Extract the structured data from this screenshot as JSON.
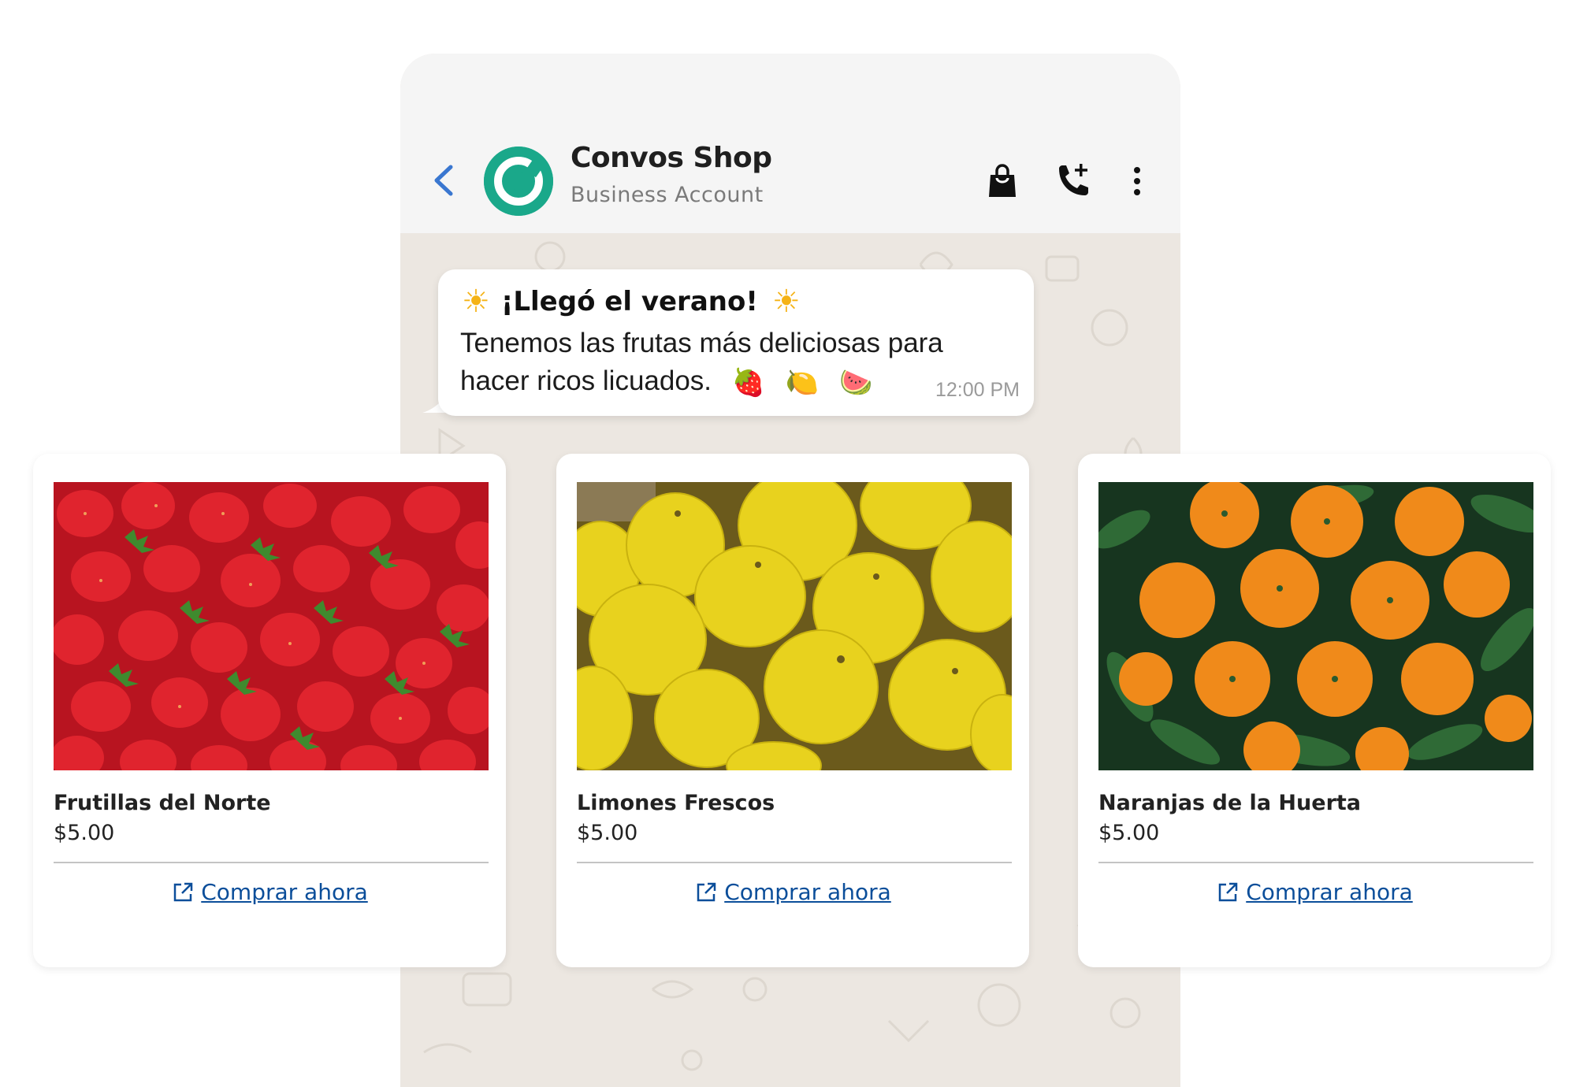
{
  "header": {
    "contact_name": "Convos Shop",
    "contact_subtitle": "Business Account",
    "icons": [
      "back-arrow",
      "shop-bag",
      "call-add",
      "more-vertical"
    ],
    "accent": "#3a77d0",
    "avatar_color": "#1aa88a"
  },
  "message": {
    "title": "¡Llegó el verano!",
    "title_emoji": "☀",
    "text": "Tenemos las frutas más deliciosas para hacer ricos licuados.",
    "emojis": [
      "🍓",
      "🍋",
      "🍉"
    ],
    "time": "12:00 PM"
  },
  "products": [
    {
      "name": "Frutillas del Norte",
      "price": "$5.00",
      "cta": "Comprar ahora",
      "image": "strawberries"
    },
    {
      "name": "Limones Frescos",
      "price": "$5.00",
      "cta": "Comprar ahora",
      "image": "lemons"
    },
    {
      "name": "Naranjas de la Huerta",
      "price": "$5.00",
      "cta": "Comprar ahora",
      "image": "oranges"
    }
  ],
  "colors": {
    "link": "#0b4e9a",
    "chat_background": "#ece7e1"
  }
}
